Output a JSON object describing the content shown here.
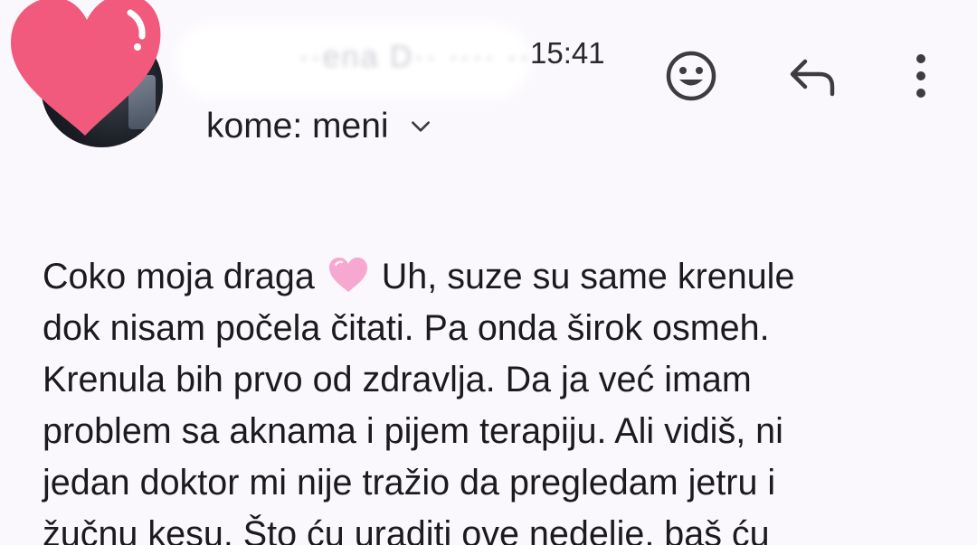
{
  "header": {
    "sender_name_obscured": "··ena D·· ···· ··",
    "time": "15:41",
    "recipient_label": "kome: meni"
  },
  "icons": {
    "sticker": "heart-sticker-icon",
    "emoji": "emoji-icon",
    "reply": "reply-icon",
    "more": "more-vert-icon",
    "expand": "chevron-down-icon",
    "inline": "pink-heart-emoji"
  },
  "colors": {
    "background": "#fbf8fd",
    "heart_sticker": "#f25a7d",
    "inline_heart": "#f7a8d0"
  },
  "message": {
    "line1_before_emoji": "Coko moja draga ",
    "line1_after_emoji": " Uh, suze su same krenule",
    "rest": "dok nisam počela čitati. Pa onda širok osmeh.\nKrenula bih prvo od zdravlja. Da ja već imam\nproblem sa aknama i pijem terapiju. Ali vidiš, ni\njedan doktor mi nije tražio da pregledam jetru i\nžučnu kesu. Što ću uraditi ove nedelje, baš ću"
  }
}
